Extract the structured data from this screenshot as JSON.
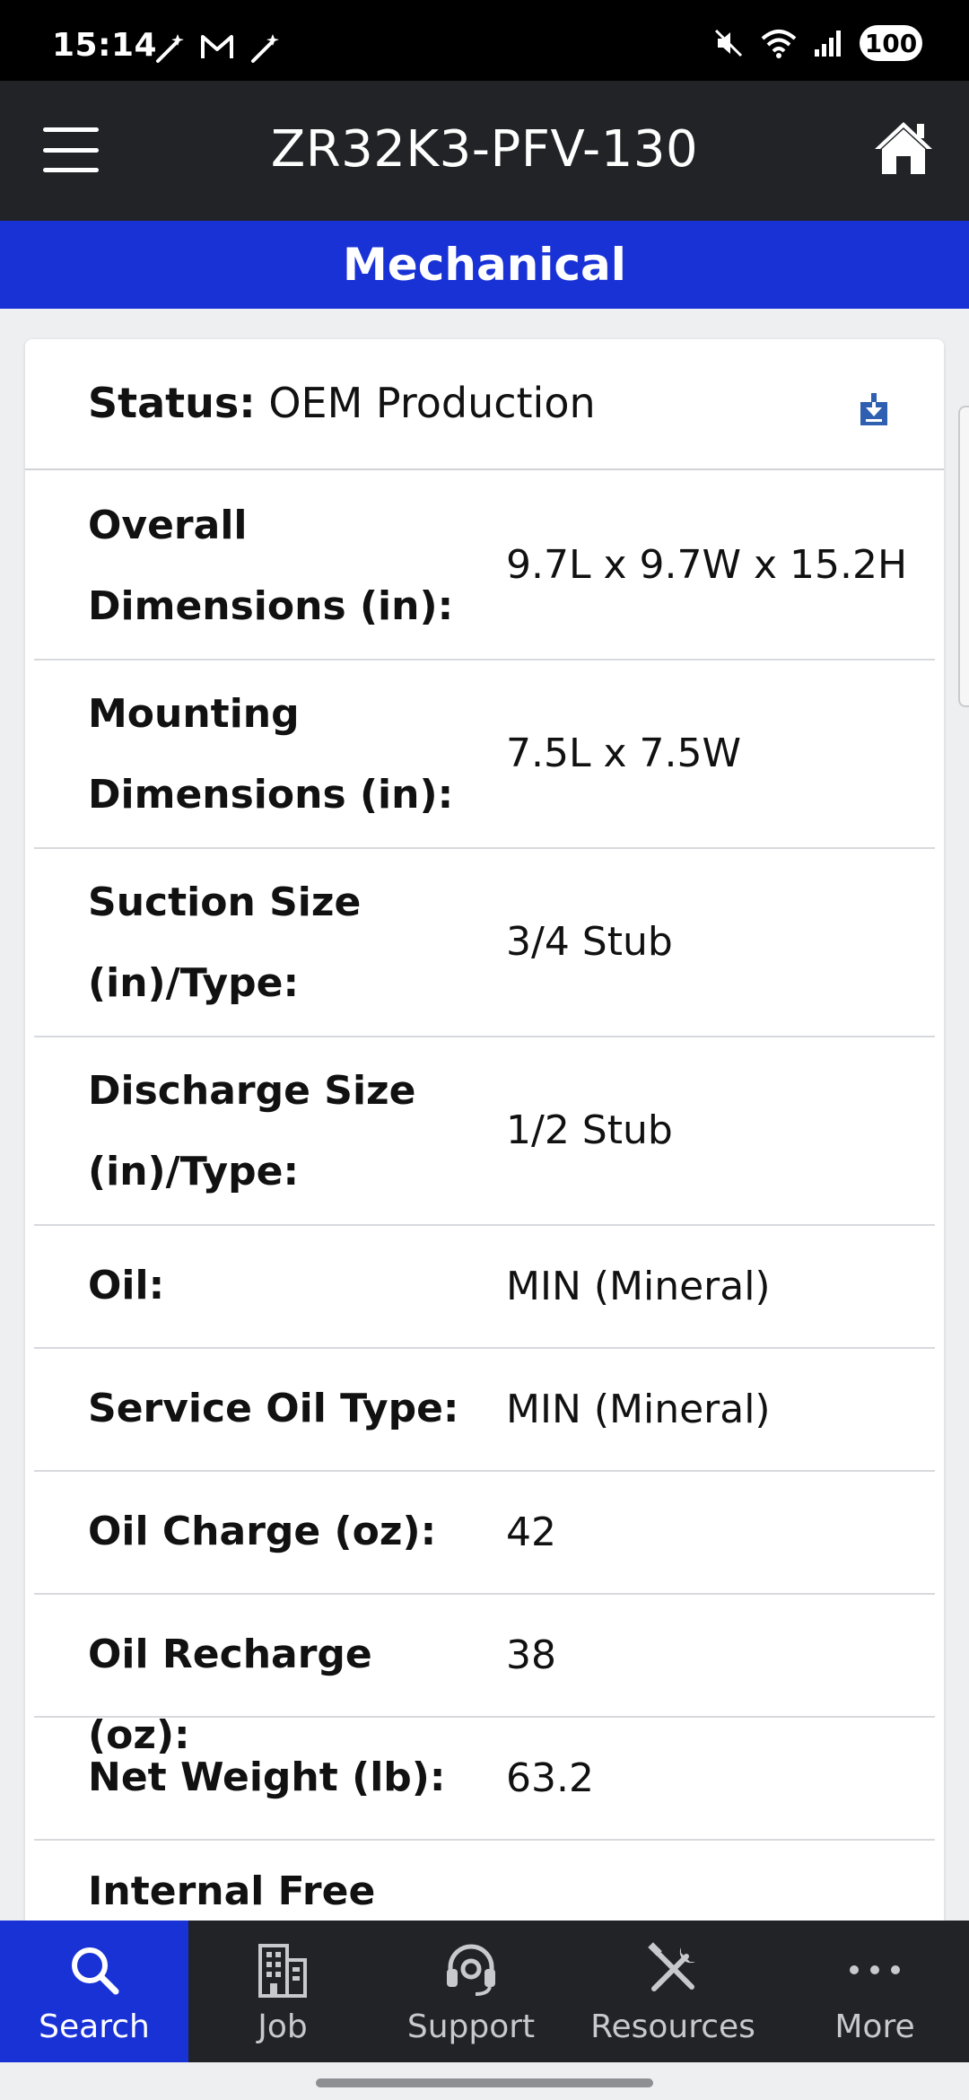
{
  "status_bar": {
    "time": "15:14",
    "battery": "100"
  },
  "header": {
    "title": "ZR32K3-PFV-130"
  },
  "section": {
    "title": "Mechanical"
  },
  "status": {
    "label": "Status:",
    "value": "OEM Production"
  },
  "specs": [
    {
      "label": "Overall Dimensions (in):",
      "value": "9.7L x 9.7W x 15.2H"
    },
    {
      "label": "Mounting Dimensions (in):",
      "value": "7.5L x 7.5W"
    },
    {
      "label": "Suction Size (in)/Type:",
      "value": "3/4 Stub"
    },
    {
      "label": "Discharge Size (in)/Type:",
      "value": "1/2 Stub"
    },
    {
      "label": "Oil:",
      "value": "MIN (Mineral)"
    },
    {
      "label": "Service Oil Type:",
      "value": "MIN (Mineral)"
    },
    {
      "label": "Oil Charge (oz):",
      "value": "42"
    },
    {
      "label": "Oil Recharge (oz):",
      "value": "38"
    },
    {
      "label": "Net Weight (lb):",
      "value": "63.2"
    },
    {
      "label": "Internal Free",
      "value": ""
    }
  ],
  "nav": [
    {
      "label": "Search",
      "icon": "search-icon"
    },
    {
      "label": "Job",
      "icon": "building-icon"
    },
    {
      "label": "Support",
      "icon": "headset-icon"
    },
    {
      "label": "Resources",
      "icon": "tools-icon"
    },
    {
      "label": "More",
      "icon": "more-icon"
    }
  ],
  "colors": {
    "brand_blue": "#1932d6",
    "header_dark": "#222326",
    "download_blue": "#2f5fb0"
  }
}
